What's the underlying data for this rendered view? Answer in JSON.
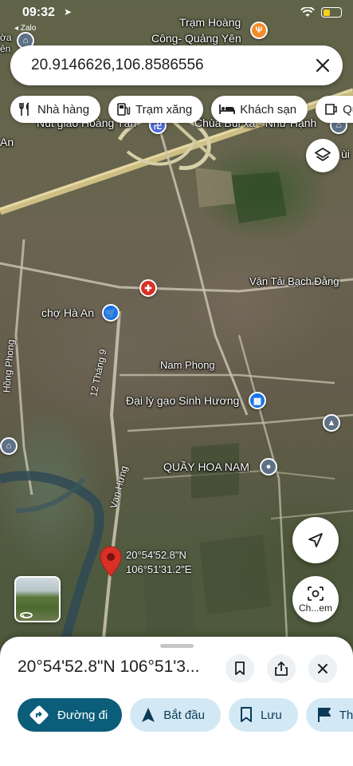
{
  "status_bar": {
    "time": "09:32",
    "back_app": "◂ Zalo"
  },
  "search": {
    "query": "20.9146626,106.8586556"
  },
  "chips": [
    {
      "label": "Nhà hàng",
      "icon": "restaurant-icon"
    },
    {
      "label": "Trạm xăng",
      "icon": "gas-station-icon"
    },
    {
      "label": "Khách sạn",
      "icon": "hotel-icon"
    },
    {
      "label": "Qu",
      "icon": "shopping-icon"
    }
  ],
  "map": {
    "top_labels": {
      "tram_hoang_line1": "Trạm Hoàng",
      "tram_hoang_line2": "Công- Quảng Yên",
      "left_cut_1": "ờa",
      "left_cut_2": "ên",
      "nut_giao": "Nút giao Hoàng Tân",
      "chua": "Chùa Bùi xá - Như Hạnh",
      "left_an": "An",
      "right_ui": "ùi"
    },
    "places": {
      "van_tai": "Vận Tải Bạch Đằng",
      "cho_ha_an": "chợ Hà An",
      "nam_phong": "Nam Phong",
      "dai_ly_gao": "Đại lý gạo Sinh Hương",
      "quay_hoa": "QUẦY HOA NAM"
    },
    "roads": {
      "hong_phong": "Hồng Phong",
      "thang_9": "12 Tháng 9",
      "van_hung": "Vạn Hưng"
    },
    "pin": {
      "lat": "20°54'52.8\"N",
      "lng": "106°51'31.2\"E",
      "color": "#d93025"
    }
  },
  "lens_button": {
    "label": "Ch...em"
  },
  "sheet": {
    "title": "20°54'52.8\"N 106°51'3..."
  },
  "actions": [
    {
      "label": "Đường đi",
      "icon": "directions-icon"
    },
    {
      "label": "Bắt đầu",
      "icon": "navigation-start-icon"
    },
    {
      "label": "Lưu",
      "icon": "bookmark-icon"
    },
    {
      "label": "Th",
      "icon": "flag-icon"
    }
  ],
  "colors": {
    "primary_action": "#0b5d79",
    "secondary_action": "#d3e8f5",
    "pin": "#d93025",
    "poi_blue": "#1a73e8",
    "poi_red": "#d93025"
  }
}
